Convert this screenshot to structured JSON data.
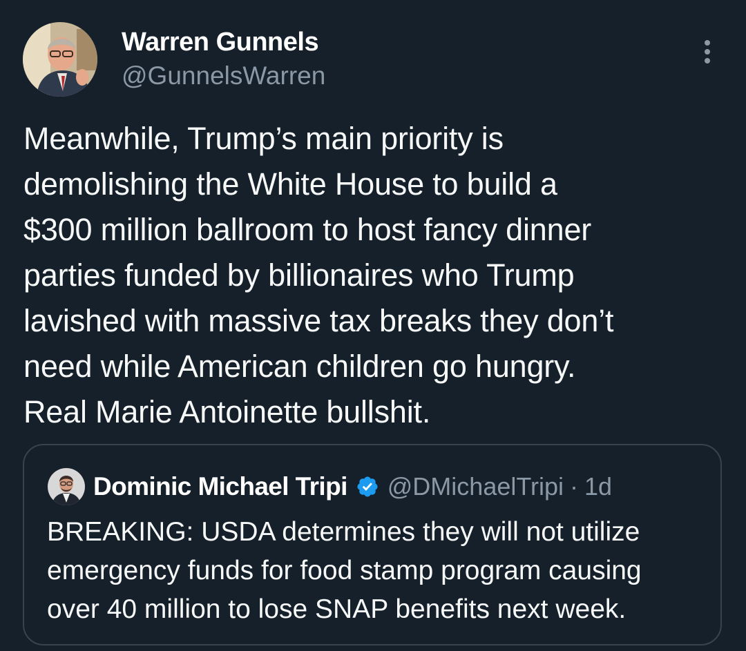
{
  "tweet": {
    "author_name": "Warren Gunnels",
    "author_handle": "@GunnelsWarren",
    "text_lines": [
      "Meanwhile, Trump’s main priority is",
      "demolishing the White House to build a",
      "$300 million ballroom to host fancy dinner",
      "parties funded by billionaires who Trump",
      "lavished with massive tax breaks they don’t",
      "need while American children go hungry.",
      "Real Marie Antoinette bullshit."
    ],
    "more_icon": "more-vertical-icon",
    "avatar_icon": "profile-photo"
  },
  "quote": {
    "author_name": "Dominic Michael Tripi",
    "verified_icon": "verified-badge-icon",
    "author_handle": "@DMichaelTripi",
    "separator": "·",
    "time": "1d",
    "text_lines": [
      "BREAKING: USDA determines they will not utilize",
      "emergency funds for food stamp program causing",
      "over 40 million to lose SNAP benefits next week."
    ],
    "avatar_icon": "profile-photo"
  },
  "colors": {
    "background": "#16202b",
    "primary_text": "#f7f9f9",
    "secondary_text": "#8b98a5",
    "border": "#38444d",
    "verified": "#1d9bf0"
  }
}
